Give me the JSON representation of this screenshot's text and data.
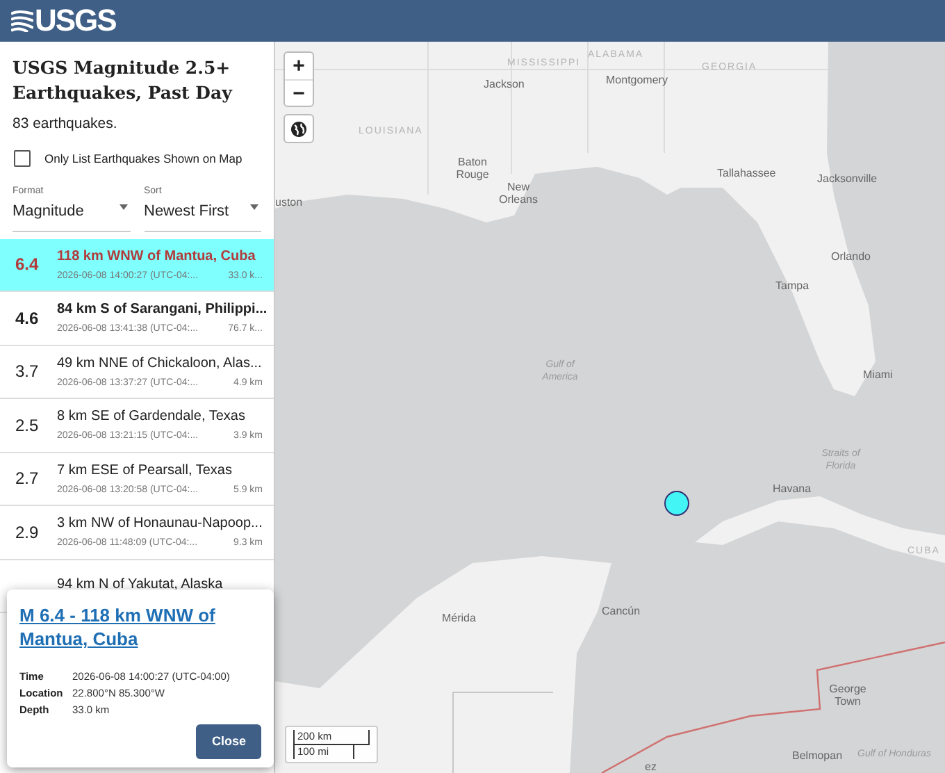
{
  "header": {
    "logo": "USGS"
  },
  "sidebar": {
    "title": "USGS Magnitude 2.5+ Earthquakes, Past Day",
    "count": "83 earthquakes.",
    "filter": {
      "label": "Only List Earthquakes Shown on Map",
      "checked": false
    },
    "selects": [
      {
        "label": "Format",
        "value": "Magnitude"
      },
      {
        "label": "Sort",
        "value": "Newest First"
      }
    ],
    "earthquakes": [
      {
        "mag": "6.4",
        "place": "118 km WNW of Mantua, Cuba",
        "time": "2026-06-08 14:00:27 (UTC-04:...",
        "depth": "33.0 k...",
        "selected": true,
        "bold": true
      },
      {
        "mag": "4.6",
        "place": "84 km S of Sarangani, Philippi...",
        "time": "2026-06-08 13:41:38 (UTC-04:...",
        "depth": "76.7 k...",
        "selected": false,
        "bold": true
      },
      {
        "mag": "3.7",
        "place": "49 km NNE of Chickaloon, Alas...",
        "time": "2026-06-08 13:37:27 (UTC-04:...",
        "depth": "4.9 km",
        "selected": false,
        "bold": false
      },
      {
        "mag": "2.5",
        "place": "8 km SE of Gardendale, Texas",
        "time": "2026-06-08 13:21:15 (UTC-04:...",
        "depth": "3.9 km",
        "selected": false,
        "bold": false
      },
      {
        "mag": "2.7",
        "place": "7 km ESE of Pearsall, Texas",
        "time": "2026-06-08 13:20:58 (UTC-04:...",
        "depth": "5.9 km",
        "selected": false,
        "bold": false
      },
      {
        "mag": "2.9",
        "place": "3 km NW of Honaunau-Napoop...",
        "time": "2026-06-08 11:48:09 (UTC-04:...",
        "depth": "9.3 km",
        "selected": false,
        "bold": false
      },
      {
        "place": "94 km N of Yakutat, Alaska",
        "selected": false,
        "bold": false
      }
    ]
  },
  "map": {
    "controls": [
      {
        "glyph": "+"
      },
      {
        "glyph": "−"
      }
    ],
    "labels": [
      {
        "text": "MISSISSIPPI",
        "kind": "region"
      },
      {
        "text": "ALABAMA",
        "kind": "region"
      },
      {
        "text": "GEORGIA",
        "kind": "region"
      },
      {
        "text": "Jackson",
        "kind": "city"
      },
      {
        "text": "Montgomery",
        "kind": "city"
      },
      {
        "text": "LOUISIANA",
        "kind": "region"
      },
      {
        "text": "Baton Rouge",
        "kind": "city"
      },
      {
        "text": "uston",
        "kind": "city"
      },
      {
        "text": "New Orleans",
        "kind": "city"
      },
      {
        "text": "Tallahassee",
        "kind": "city"
      },
      {
        "text": "Jacksonville",
        "kind": "city"
      },
      {
        "text": "Orlando",
        "kind": "city"
      },
      {
        "text": "Tampa",
        "kind": "city"
      },
      {
        "text": "Gulf of America",
        "kind": "water"
      },
      {
        "text": "Miami",
        "kind": "city"
      },
      {
        "text": "Straits of Florida",
        "kind": "water"
      },
      {
        "text": "Havana",
        "kind": "city"
      },
      {
        "text": "CUBA",
        "kind": "region"
      },
      {
        "text": "Mérida",
        "kind": "city"
      },
      {
        "text": "Cancún",
        "kind": "city"
      },
      {
        "text": "George Town",
        "kind": "city"
      },
      {
        "text": "ez",
        "kind": "city"
      },
      {
        "text": "Belmopan",
        "kind": "city"
      },
      {
        "text": "Gulf of Honduras",
        "kind": "water"
      }
    ],
    "scale": [
      "200 km",
      "100 mi"
    ]
  },
  "popup": {
    "title": "M 6.4 - 118 km WNW of Mantua, Cuba",
    "rows": [
      {
        "label": "Time",
        "value": "2026-06-08 14:00:27 (UTC-04:00)"
      },
      {
        "label": "Location",
        "value": "22.800°N 85.300°W"
      },
      {
        "label": "Depth",
        "value": "33.0 km"
      }
    ],
    "button": "Close"
  }
}
